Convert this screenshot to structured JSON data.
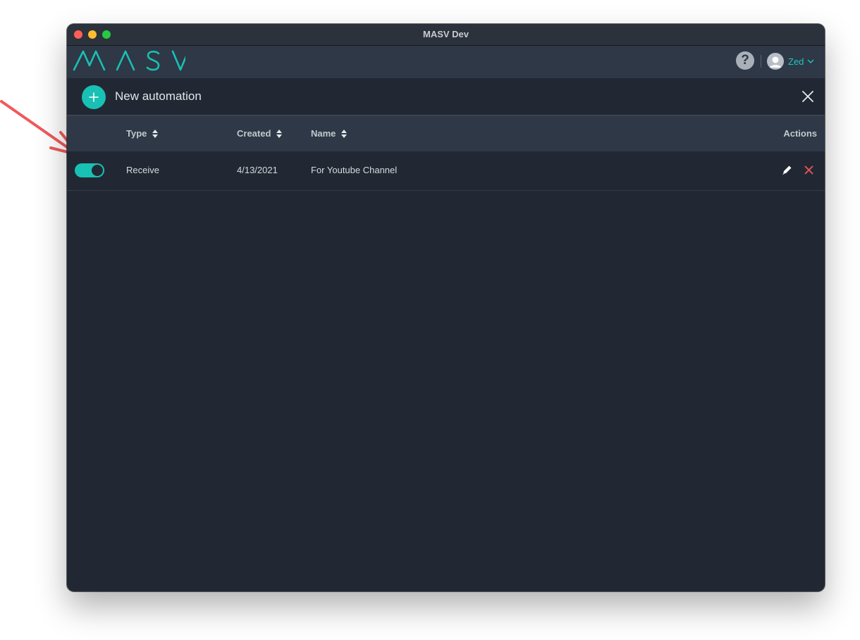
{
  "window": {
    "title": "MASV Dev"
  },
  "app_bar": {
    "logo_text": "MASV",
    "help_symbol": "?",
    "user_name": "Zed",
    "accent_color": "#19c0b4"
  },
  "action_bar": {
    "new_automation_label": "New automation"
  },
  "table": {
    "columns": {
      "type": "Type",
      "created": "Created",
      "name": "Name",
      "actions": "Actions"
    },
    "rows": [
      {
        "enabled": true,
        "type": "Receive",
        "created": "4/13/2021",
        "name": "For Youtube Channel"
      }
    ]
  },
  "icons": {
    "add": "plus-icon",
    "close": "close-icon",
    "sort": "sort-arrows-icon",
    "edit": "pencil-icon",
    "delete": "x-icon",
    "user": "user-avatar-icon",
    "help": "question-icon",
    "dropdown": "chevron-down-icon"
  },
  "colors": {
    "delete": "#e85555",
    "annotation": "#f05a5a"
  }
}
